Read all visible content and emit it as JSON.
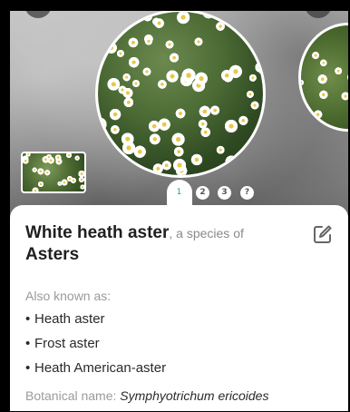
{
  "carousel": {
    "pages": [
      "1",
      "2",
      "3",
      "?"
    ],
    "active_page": 0
  },
  "plant": {
    "common_name": "White heath aster",
    "species_connector": ", a species of",
    "genus": "Asters",
    "also_known_as_label": "Also known as:",
    "also_known_as": [
      "Heath aster",
      "Frost aster",
      "Heath American-aster"
    ],
    "bullet": "•",
    "botanical_label": "Botanical name: ",
    "botanical_name": "Symphyotrichum ericoides"
  },
  "icons": {
    "edit": "pencil-square-icon"
  },
  "colors": {
    "accent": "#2a9d8f",
    "text_primary": "#1f1f1f",
    "text_secondary": "#9a9a9a"
  }
}
